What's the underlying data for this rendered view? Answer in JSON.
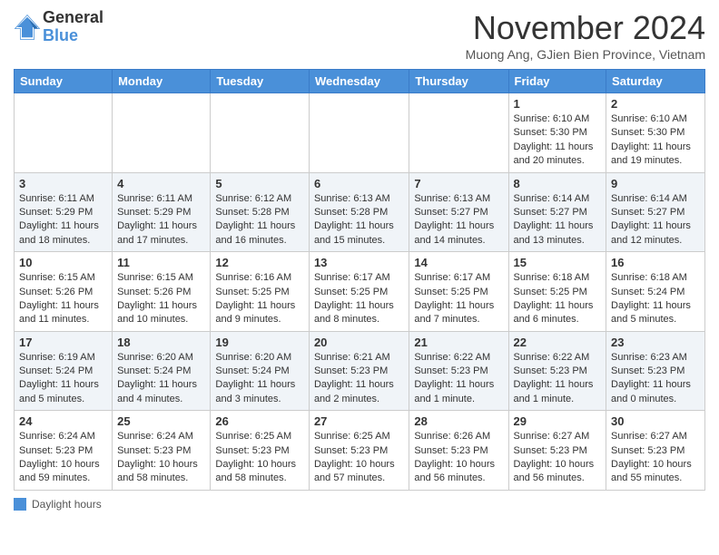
{
  "header": {
    "logo_general": "General",
    "logo_blue": "Blue",
    "month_title": "November 2024",
    "location": "Muong Ang, GJien Bien Province, Vietnam"
  },
  "days_of_week": [
    "Sunday",
    "Monday",
    "Tuesday",
    "Wednesday",
    "Thursday",
    "Friday",
    "Saturday"
  ],
  "legend": {
    "label": "Daylight hours"
  },
  "weeks": [
    {
      "days": [
        {
          "num": "",
          "info": ""
        },
        {
          "num": "",
          "info": ""
        },
        {
          "num": "",
          "info": ""
        },
        {
          "num": "",
          "info": ""
        },
        {
          "num": "",
          "info": ""
        },
        {
          "num": "1",
          "info": "Sunrise: 6:10 AM\nSunset: 5:30 PM\nDaylight: 11 hours and 20 minutes."
        },
        {
          "num": "2",
          "info": "Sunrise: 6:10 AM\nSunset: 5:30 PM\nDaylight: 11 hours and 19 minutes."
        }
      ]
    },
    {
      "days": [
        {
          "num": "3",
          "info": "Sunrise: 6:11 AM\nSunset: 5:29 PM\nDaylight: 11 hours and 18 minutes."
        },
        {
          "num": "4",
          "info": "Sunrise: 6:11 AM\nSunset: 5:29 PM\nDaylight: 11 hours and 17 minutes."
        },
        {
          "num": "5",
          "info": "Sunrise: 6:12 AM\nSunset: 5:28 PM\nDaylight: 11 hours and 16 minutes."
        },
        {
          "num": "6",
          "info": "Sunrise: 6:13 AM\nSunset: 5:28 PM\nDaylight: 11 hours and 15 minutes."
        },
        {
          "num": "7",
          "info": "Sunrise: 6:13 AM\nSunset: 5:27 PM\nDaylight: 11 hours and 14 minutes."
        },
        {
          "num": "8",
          "info": "Sunrise: 6:14 AM\nSunset: 5:27 PM\nDaylight: 11 hours and 13 minutes."
        },
        {
          "num": "9",
          "info": "Sunrise: 6:14 AM\nSunset: 5:27 PM\nDaylight: 11 hours and 12 minutes."
        }
      ]
    },
    {
      "days": [
        {
          "num": "10",
          "info": "Sunrise: 6:15 AM\nSunset: 5:26 PM\nDaylight: 11 hours and 11 minutes."
        },
        {
          "num": "11",
          "info": "Sunrise: 6:15 AM\nSunset: 5:26 PM\nDaylight: 11 hours and 10 minutes."
        },
        {
          "num": "12",
          "info": "Sunrise: 6:16 AM\nSunset: 5:25 PM\nDaylight: 11 hours and 9 minutes."
        },
        {
          "num": "13",
          "info": "Sunrise: 6:17 AM\nSunset: 5:25 PM\nDaylight: 11 hours and 8 minutes."
        },
        {
          "num": "14",
          "info": "Sunrise: 6:17 AM\nSunset: 5:25 PM\nDaylight: 11 hours and 7 minutes."
        },
        {
          "num": "15",
          "info": "Sunrise: 6:18 AM\nSunset: 5:25 PM\nDaylight: 11 hours and 6 minutes."
        },
        {
          "num": "16",
          "info": "Sunrise: 6:18 AM\nSunset: 5:24 PM\nDaylight: 11 hours and 5 minutes."
        }
      ]
    },
    {
      "days": [
        {
          "num": "17",
          "info": "Sunrise: 6:19 AM\nSunset: 5:24 PM\nDaylight: 11 hours and 5 minutes."
        },
        {
          "num": "18",
          "info": "Sunrise: 6:20 AM\nSunset: 5:24 PM\nDaylight: 11 hours and 4 minutes."
        },
        {
          "num": "19",
          "info": "Sunrise: 6:20 AM\nSunset: 5:24 PM\nDaylight: 11 hours and 3 minutes."
        },
        {
          "num": "20",
          "info": "Sunrise: 6:21 AM\nSunset: 5:23 PM\nDaylight: 11 hours and 2 minutes."
        },
        {
          "num": "21",
          "info": "Sunrise: 6:22 AM\nSunset: 5:23 PM\nDaylight: 11 hours and 1 minute."
        },
        {
          "num": "22",
          "info": "Sunrise: 6:22 AM\nSunset: 5:23 PM\nDaylight: 11 hours and 1 minute."
        },
        {
          "num": "23",
          "info": "Sunrise: 6:23 AM\nSunset: 5:23 PM\nDaylight: 11 hours and 0 minutes."
        }
      ]
    },
    {
      "days": [
        {
          "num": "24",
          "info": "Sunrise: 6:24 AM\nSunset: 5:23 PM\nDaylight: 10 hours and 59 minutes."
        },
        {
          "num": "25",
          "info": "Sunrise: 6:24 AM\nSunset: 5:23 PM\nDaylight: 10 hours and 58 minutes."
        },
        {
          "num": "26",
          "info": "Sunrise: 6:25 AM\nSunset: 5:23 PM\nDaylight: 10 hours and 58 minutes."
        },
        {
          "num": "27",
          "info": "Sunrise: 6:25 AM\nSunset: 5:23 PM\nDaylight: 10 hours and 57 minutes."
        },
        {
          "num": "28",
          "info": "Sunrise: 6:26 AM\nSunset: 5:23 PM\nDaylight: 10 hours and 56 minutes."
        },
        {
          "num": "29",
          "info": "Sunrise: 6:27 AM\nSunset: 5:23 PM\nDaylight: 10 hours and 56 minutes."
        },
        {
          "num": "30",
          "info": "Sunrise: 6:27 AM\nSunset: 5:23 PM\nDaylight: 10 hours and 55 minutes."
        }
      ]
    }
  ]
}
